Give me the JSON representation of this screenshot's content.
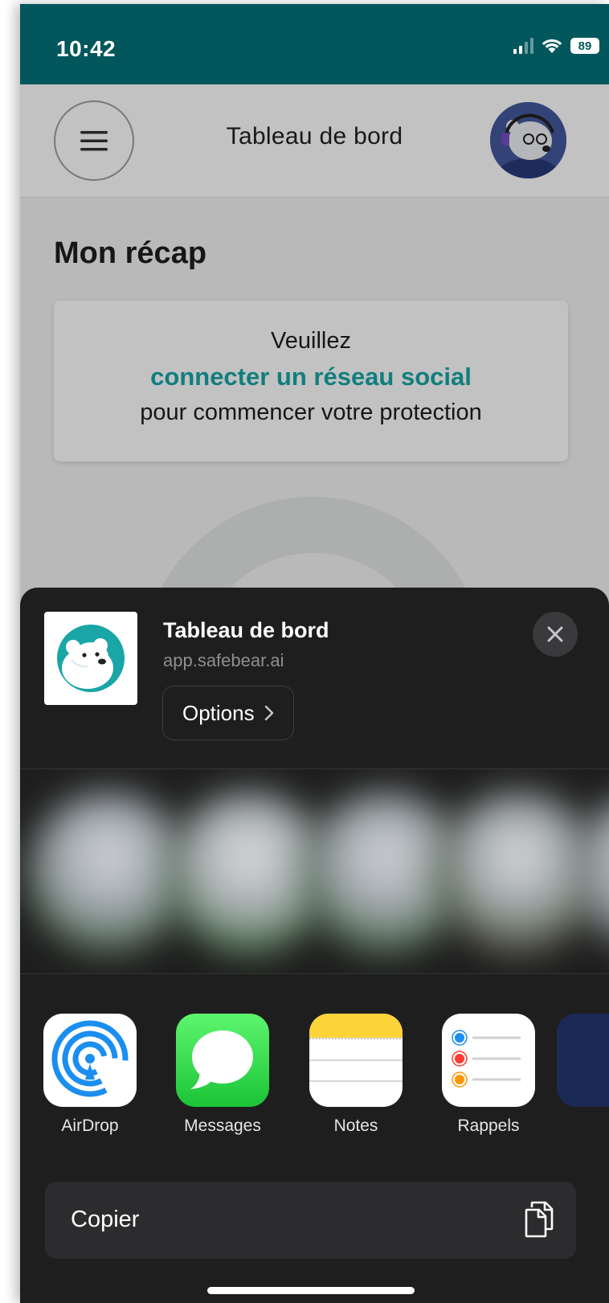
{
  "status_bar": {
    "time": "10:42",
    "battery": "89"
  },
  "header": {
    "title": "Tableau de bord"
  },
  "main": {
    "section_title": "Mon récap",
    "card": {
      "line1": "Veuillez",
      "link": "connecter un réseau social",
      "line3": "pour commencer votre protection"
    }
  },
  "share_sheet": {
    "title": "Tableau de bord",
    "url": "app.safebear.ai",
    "options_label": "Options",
    "apps": [
      {
        "label": "AirDrop",
        "icon": "airdrop-icon"
      },
      {
        "label": "Messages",
        "icon": "messages-icon"
      },
      {
        "label": "Notes",
        "icon": "notes-icon"
      },
      {
        "label": "Rappels",
        "icon": "reminders-icon"
      }
    ],
    "copy_label": "Copier"
  },
  "colors": {
    "status_bar_bg": "#02575c",
    "accent": "#17a6a6",
    "sheet_bg": "#1e1e1e"
  }
}
